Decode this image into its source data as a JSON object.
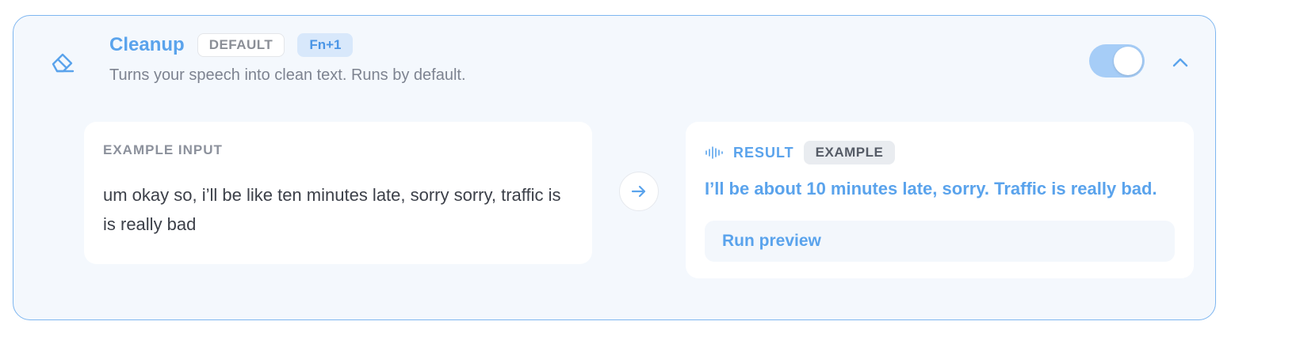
{
  "mode": {
    "title": "Cleanup",
    "badge": "DEFAULT",
    "shortcut": "Fn+1",
    "description": "Turns your speech into clean text. Runs by default.",
    "icon": "eraser-icon",
    "enabled": true,
    "expanded": true
  },
  "example": {
    "input_label": "EXAMPLE INPUT",
    "input_text": "um okay so, i’ll be like ten minutes late, sorry sorry, traffic is is really bad",
    "result_label": "RESULT",
    "result_badge": "EXAMPLE",
    "result_text": "I’ll be about 10 minutes late, sorry. Traffic is really bad.",
    "run_button": "Run preview"
  },
  "colors": {
    "accent": "#5aa3ec",
    "card_border": "#7eb6f0",
    "card_background": "#f4f8fd",
    "toggle_on": "#a6cdf7"
  }
}
